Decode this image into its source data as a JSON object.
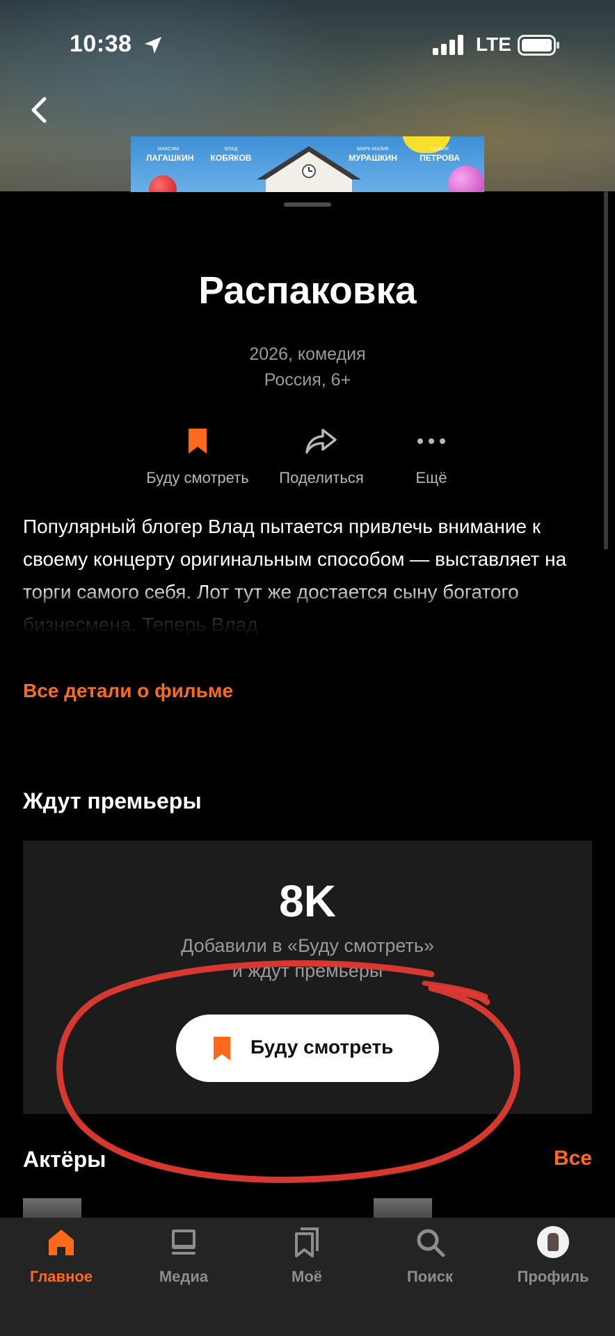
{
  "status_bar": {
    "time": "10:38",
    "network": "LTE"
  },
  "poster": {
    "actors": [
      {
        "first": "Максим",
        "last": "Лагашкин"
      },
      {
        "first": "Влад",
        "last": "Кобяков"
      },
      {
        "first": "Марк-Малик",
        "last": "Мурашкин"
      },
      {
        "first": "София",
        "last": "Петрова"
      }
    ]
  },
  "movie": {
    "title": "Распаковка",
    "year_genre": "2026, комедия",
    "country_age": "Россия, 6+",
    "description": "Популярный блогер Влад пытается привлечь внимание к своему концерту оригинальным способом — выставляет на торги самого себя. Лот тут же достается сыну богатого бизнесмена. Теперь Влад",
    "details_link": "Все детали о фильме"
  },
  "actions": {
    "watch_later": "Буду смотреть",
    "share": "Поделиться",
    "more": "Ещё"
  },
  "premiere": {
    "section_title": "Ждут премьеры",
    "count": "8K",
    "text_line1": "Добавили в «Буду смотреть»",
    "text_line2": "и ждут премьеры",
    "button_label": "Буду смотреть"
  },
  "actors": {
    "section_title": "Актёры",
    "all_link": "Все"
  },
  "tabbar": {
    "tabs": [
      {
        "label": "Главное",
        "icon": "home-icon",
        "active": true
      },
      {
        "label": "Медиа",
        "icon": "media-icon",
        "active": false
      },
      {
        "label": "Моё",
        "icon": "bookmarks-icon",
        "active": false
      },
      {
        "label": "Поиск",
        "icon": "search-icon",
        "active": false
      },
      {
        "label": "Профиль",
        "icon": "avatar",
        "active": false
      }
    ]
  },
  "colors": {
    "accent": "#ff6a1a",
    "background": "#000000",
    "card": "#1c1c1c",
    "tabbar": "#242424",
    "annotation": "#e23b33"
  }
}
